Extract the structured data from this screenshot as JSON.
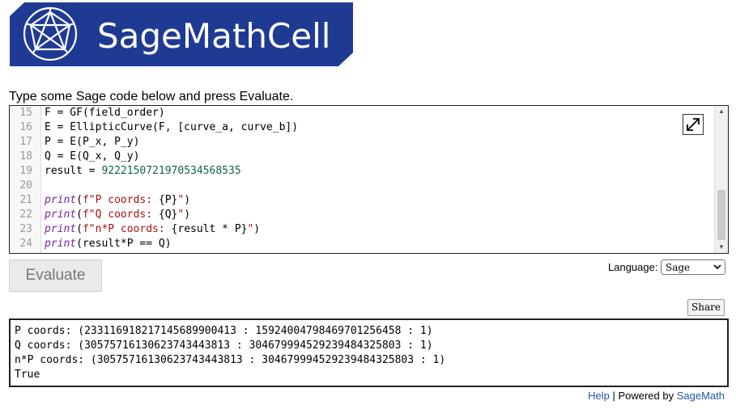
{
  "logo": {
    "text": "SageMathCell",
    "color": "#1f3a93"
  },
  "intro": "Type some Sage code below and press Evaluate.",
  "editor": {
    "lines": [
      {
        "n": "15",
        "segments": [
          {
            "t": "F = GF(field_order)",
            "c": ""
          }
        ]
      },
      {
        "n": "16",
        "segments": [
          {
            "t": "E = EllipticCurve(F, [curve_a, curve_b])",
            "c": ""
          }
        ]
      },
      {
        "n": "17",
        "segments": [
          {
            "t": "P = E(P_x, P_y)",
            "c": ""
          }
        ]
      },
      {
        "n": "18",
        "segments": [
          {
            "t": "Q = E(Q_x, Q_y)",
            "c": ""
          }
        ]
      },
      {
        "n": "19",
        "segments": [
          {
            "t": "result = ",
            "c": ""
          },
          {
            "t": "9222150721970534568535",
            "c": "num"
          }
        ]
      },
      {
        "n": "20",
        "segments": []
      },
      {
        "n": "21",
        "segments": [
          {
            "t": "print",
            "c": "kw"
          },
          {
            "t": "(",
            "c": ""
          },
          {
            "t": "f\"P coords: ",
            "c": "str"
          },
          {
            "t": "{P}",
            "c": ""
          },
          {
            "t": "\"",
            "c": "str"
          },
          {
            "t": ")",
            "c": ""
          }
        ]
      },
      {
        "n": "22",
        "segments": [
          {
            "t": "print",
            "c": "kw"
          },
          {
            "t": "(",
            "c": ""
          },
          {
            "t": "f\"Q coords: ",
            "c": "str"
          },
          {
            "t": "{Q}",
            "c": ""
          },
          {
            "t": "\"",
            "c": "str"
          },
          {
            "t": ")",
            "c": ""
          }
        ]
      },
      {
        "n": "23",
        "segments": [
          {
            "t": "print",
            "c": "kw"
          },
          {
            "t": "(",
            "c": ""
          },
          {
            "t": "f\"n*P coords: ",
            "c": "str"
          },
          {
            "t": "{result * P}",
            "c": ""
          },
          {
            "t": "\"",
            "c": "str"
          },
          {
            "t": ")",
            "c": ""
          }
        ]
      },
      {
        "n": "24",
        "segments": [
          {
            "t": "print",
            "c": "kw"
          },
          {
            "t": "(result*P == Q)",
            "c": ""
          }
        ]
      }
    ],
    "fullscreen_icon": "expand-icon"
  },
  "evaluate_label": "Evaluate",
  "language": {
    "label": "Language:",
    "selected": "Sage"
  },
  "share_label": "Share",
  "output_lines": [
    "P coords: (23311691821714568990041З : 15924004798469701256458 : 1)",
    "Q coords: (30575716130623743443813 : 30467999452923948432580З : 1)",
    "n*P coords: (30575716130623743443813 : 30467999452923948432580З : 1)",
    "True"
  ],
  "footer": {
    "help": "Help",
    "powered": " | Powered by ",
    "sagemath": "SageMath"
  }
}
